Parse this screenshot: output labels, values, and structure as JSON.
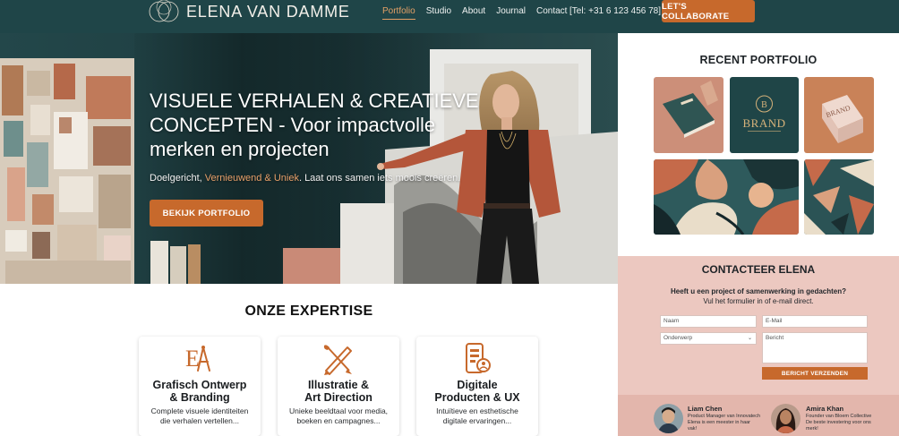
{
  "nav": {
    "brand": "ELENA VAN DAMME",
    "links": [
      "Portfolio",
      "Studio",
      "About",
      "Journal",
      "Contact"
    ],
    "phone": "[Tel: +31 6 123 456 78]",
    "cta": "LET'S COLLABORATE"
  },
  "hero": {
    "title": "VISUELE VERHALEN & CREATIEVE CONCEPTEN - Voor impactvolle merken en projecten",
    "sub_part1": "Doelgericht, ",
    "sub_accent": "Vernieuwend & Uniek",
    "sub_part2": ". Laat ons samen iets moois creëren.",
    "button": "BEKIJK PORTFOLIO"
  },
  "portfolio": {
    "title": "RECENT PORTFOLIO",
    "brand_card_text": "BRAND",
    "box_card_text": "BRAND"
  },
  "contact": {
    "title": "CONTACTEER ELENA",
    "question": "Heeft u een project of samenwerking in gedachten?",
    "instruction": "Vul het formulier in of e-mail direct.",
    "name_placeholder": "Naam",
    "email_placeholder": "E-Mail",
    "subject_placeholder": "Onderwerp",
    "message_placeholder": "Bericht",
    "send": "BERICHT VERZENDEN"
  },
  "testimonials": [
    {
      "name": "Liam Chen",
      "role": "Product Manager van Innovatech",
      "quote": "Elena is een meester in haar vak!"
    },
    {
      "name": "Amira Khan",
      "role": "Founder van Bloem Collective",
      "quote": "De beste investering voor ons merk!"
    }
  ],
  "expertise": {
    "title": "ONZE EXPERTISE",
    "cards": [
      {
        "title1": "Grafisch Ontwerp",
        "title2": "& Branding",
        "text1": "Complete visuele identiteiten",
        "text2": "die verhalen vertellen..."
      },
      {
        "title1": "Illustratie &",
        "title2": "Art Direction",
        "text1": "Unieke beeldtaal voor media,",
        "text2": "boeken en campagnes..."
      },
      {
        "title1": "Digitale",
        "title2": "Producten & UX",
        "text1": "Intuïtieve en esthetische",
        "text2": "digitale ervaringen..."
      }
    ]
  },
  "colors": {
    "nav_bg": "#1f4548",
    "accent": "#c7692c",
    "contact_bg": "#ecc8c0",
    "testimonial_bg": "#e3b6ac"
  }
}
